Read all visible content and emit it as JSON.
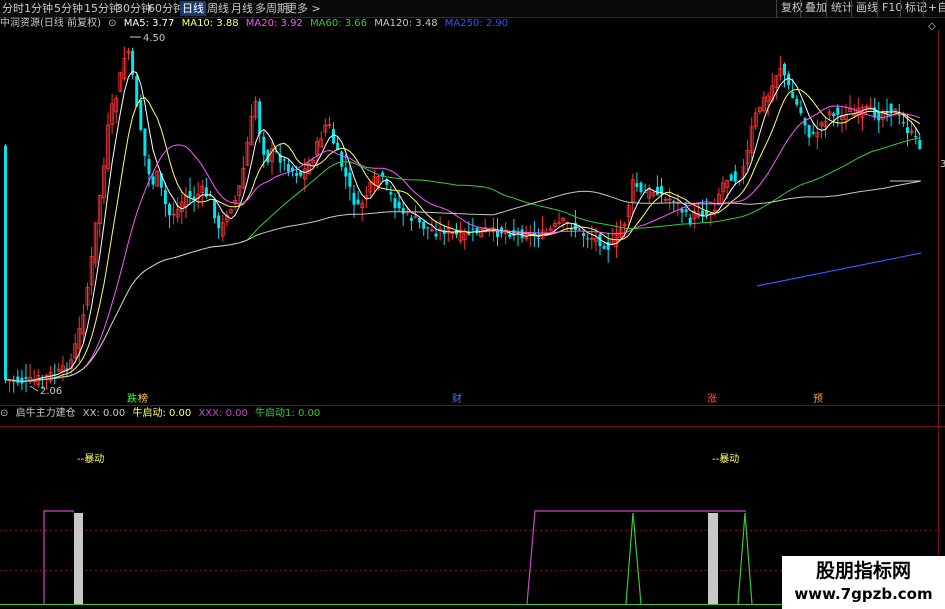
{
  "toolbar": {
    "periods": [
      "分时",
      "1分钟",
      "5分钟",
      "15分钟",
      "30分钟",
      "60分钟",
      "日线",
      "周线",
      "月线",
      "多周期",
      "更多 >"
    ],
    "active_period": "日线",
    "right_buttons": [
      "复权",
      "叠加",
      "统计",
      "画线",
      "F10",
      "标记",
      "+自"
    ]
  },
  "main_chart": {
    "title": "中润资源(日线 前复权)",
    "ma_legend": [
      {
        "label": "MA5: 3.77",
        "color": "#ffffff"
      },
      {
        "label": "MA10: 3.88",
        "color": "#ffff66"
      },
      {
        "label": "MA20: 3.92",
        "color": "#ff55ff"
      },
      {
        "label": "MA60: 3.66",
        "color": "#33cc33"
      },
      {
        "label": "MA120: 3.48",
        "color": "#c8c8c8"
      },
      {
        "label": "MA250: 2.90",
        "color": "#3355ff"
      }
    ],
    "high_label": "4.50",
    "low_label": "2.06",
    "right_axis_label": "3",
    "event_markers": [
      {
        "text": "跌",
        "color": "#33ff33"
      },
      {
        "text": "榜",
        "color": "#ffcc33"
      },
      {
        "text": "财",
        "color": "#4477ff"
      },
      {
        "text": "涨",
        "color": "#ff5555"
      },
      {
        "text": "预",
        "color": "#ff9933"
      }
    ]
  },
  "sub_chart": {
    "legend": [
      {
        "label": "启牛主力建仓",
        "color": "#c8c8c8"
      },
      {
        "label": "XX: 0.00",
        "color": "#c8c8c8"
      },
      {
        "label": "牛启动: 0.00",
        "color": "#ffff66"
      },
      {
        "label": "XXX: 0.00",
        "color": "#cc44cc"
      },
      {
        "label": "牛启动1: 0.00",
        "color": "#33cc33"
      }
    ],
    "annotations": [
      "--暴动",
      "--暴动"
    ]
  },
  "colors": {
    "up": "#ff3333",
    "down": "#00e5ee",
    "grid": "#7a1010"
  },
  "watermark": {
    "line1": "股朋指标网",
    "line2": "www.7gpzb.com"
  }
}
